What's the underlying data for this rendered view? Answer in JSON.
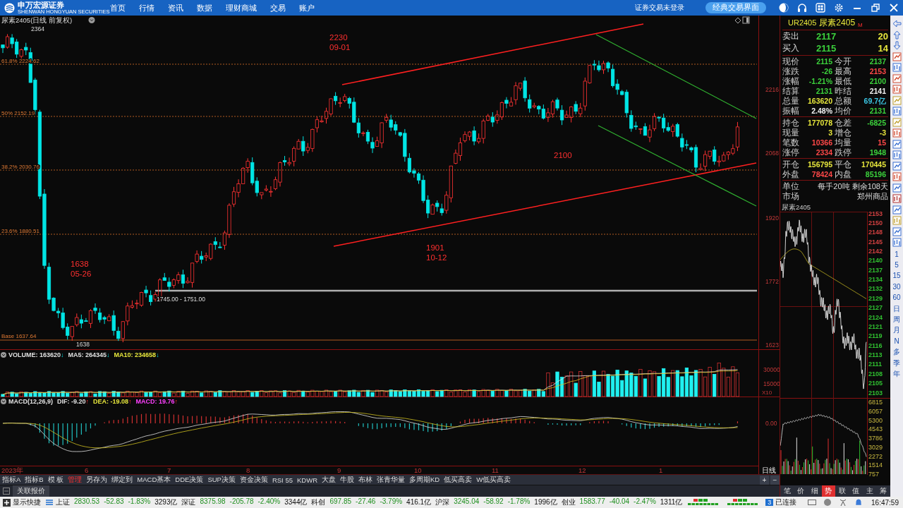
{
  "top_bar": {
    "logo": {
      "name": "申万宏源证券",
      "subtitle": "SHENWAN HONGYUAN SECURITIES"
    },
    "nav": [
      "首页",
      "行情",
      "资讯",
      "数据",
      "理财商城",
      "交易",
      "账户"
    ],
    "login_status": "证券交易未登录",
    "classic_button": "经典交易界面"
  },
  "chart": {
    "title": "尿素2405(日线 前复权)",
    "high_label": "2364",
    "low_label": "1638",
    "fib_levels": [
      {
        "label": "61.8% 2224.62"
      },
      {
        "label": "50% 2152.19"
      },
      {
        "label": "38.2% 2030.76"
      },
      {
        "label": "23.6% 1880.51"
      }
    ],
    "base_label": "Base 1637.64",
    "range_label": "1745.00 - 1751.00",
    "annotations": [
      {
        "price": "2230",
        "date": "09-01"
      },
      {
        "price": "1638",
        "date": "05-26"
      },
      {
        "price": "1901",
        "date": "10-12"
      },
      {
        "price": "2100"
      }
    ],
    "price_axis": [
      "2216",
      "2068",
      "1920",
      "1772",
      "1623"
    ],
    "volume": {
      "readings": [
        {
          "label": "VOLUME: 163620",
          "arrow": "↓",
          "color": "#e0e0e0"
        },
        {
          "label": "MA5: 264345",
          "arrow": "↓",
          "color": "#e0e0e0"
        },
        {
          "label": "MA10: 234658",
          "arrow": "↓",
          "color": "#e6e63c"
        }
      ],
      "axis": [
        "30000",
        "15000"
      ],
      "unit": "X10"
    },
    "macd": {
      "name": "MACD(12,26,9)",
      "readings": [
        {
          "label": "DIF: -9.20",
          "arrow": "↑",
          "color": "#e0e0e0"
        },
        {
          "label": "DEA: -19.08",
          "arrow": "↑",
          "color": "#e6e63c"
        },
        {
          "label": "MACD: 19.76",
          "arrow": "↑",
          "color": "#ff40ff"
        }
      ],
      "axis": "0.00"
    },
    "date_axis": [
      "2023年",
      "6",
      "7",
      "8",
      "9",
      "10",
      "11",
      "12",
      "1"
    ],
    "period_label": "日线"
  },
  "quote": {
    "code": "UR2405",
    "name": "尿素2405",
    "flag": "M",
    "bid_ask": [
      {
        "label": "卖出",
        "price": "2117",
        "volume": "20"
      },
      {
        "label": "买入",
        "price": "2115",
        "volume": "14"
      }
    ],
    "groups": [
      [
        {
          "label": "现价",
          "value": "2115",
          "color": "#3cd23c"
        },
        {
          "label": "今开",
          "value": "2137",
          "color": "#3cd23c"
        },
        {
          "label": "涨跌",
          "value": "-26",
          "color": "#3cd23c"
        },
        {
          "label": "最高",
          "value": "2153",
          "color": "#ff4848"
        },
        {
          "label": "涨幅",
          "value": "-1.21%",
          "color": "#3cd23c"
        },
        {
          "label": "最低",
          "value": "2100",
          "color": "#3cd23c"
        },
        {
          "label": "结算",
          "value": "2131",
          "color": "#3cd23c"
        },
        {
          "label": "昨结",
          "value": "2141",
          "color": "#f0f0f0"
        },
        {
          "label": "总量",
          "value": "163620",
          "color": "#e6e63c"
        },
        {
          "label": "总额",
          "value": "69.7亿",
          "color": "#3cc8e6"
        },
        {
          "label": "振幅",
          "value": "2.48%",
          "color": "#f0f0f0"
        },
        {
          "label": "均价",
          "value": "2131",
          "color": "#3cd23c"
        }
      ],
      [
        {
          "label": "持仓",
          "value": "177078",
          "color": "#e6e63c"
        },
        {
          "label": "仓差",
          "value": "-6825",
          "color": "#3cd23c"
        },
        {
          "label": "现量",
          "value": "3",
          "color": "#e6e63c"
        },
        {
          "label": "增仓",
          "value": "-3",
          "color": "#e6e63c"
        },
        {
          "label": "笔数",
          "value": "10366",
          "color": "#ff4848"
        },
        {
          "label": "均量",
          "value": "15",
          "color": "#ff4848"
        },
        {
          "label": "涨停",
          "value": "2334",
          "color": "#ff4848"
        },
        {
          "label": "跌停",
          "value": "1948",
          "color": "#3cd23c"
        }
      ],
      [
        {
          "label": "开仓",
          "value": "156795",
          "color": "#e6e63c"
        },
        {
          "label": "平仓",
          "value": "170445",
          "color": "#e6e63c"
        },
        {
          "label": "外盘",
          "value": "78424",
          "color": "#ff4848"
        },
        {
          "label": "内盘",
          "value": "85196",
          "color": "#3cd23c"
        }
      ]
    ],
    "info": [
      {
        "label": "单位",
        "value": "每手20吨 剩余108天"
      },
      {
        "label": "市场",
        "value": "郑州商品"
      }
    ]
  },
  "intraday": {
    "title": "尿素2405",
    "price_axis": [
      {
        "value": "2153",
        "color": "#d04040"
      },
      {
        "value": "2150",
        "color": "#d04040"
      },
      {
        "value": "2148",
        "color": "#d04040"
      },
      {
        "value": "2145",
        "color": "#d04040"
      },
      {
        "value": "2142",
        "color": "#d04040"
      },
      {
        "value": "2140",
        "color": "#30c030"
      },
      {
        "value": "2137",
        "color": "#30c030"
      },
      {
        "value": "2134",
        "color": "#30c030"
      },
      {
        "value": "2132",
        "color": "#30c030"
      },
      {
        "value": "2129",
        "color": "#30c030"
      },
      {
        "value": "2127",
        "color": "#30c030"
      },
      {
        "value": "2124",
        "color": "#30c030"
      },
      {
        "value": "2121",
        "color": "#30c030"
      },
      {
        "value": "2119",
        "color": "#30c030"
      },
      {
        "value": "2116",
        "color": "#30c030"
      },
      {
        "value": "2113",
        "color": "#30c030"
      },
      {
        "value": "2111",
        "color": "#30c030"
      },
      {
        "value": "2108",
        "color": "#30c030"
      },
      {
        "value": "2105",
        "color": "#30c030"
      },
      {
        "value": "2103",
        "color": "#30c030"
      }
    ],
    "volume_axis": [
      "6815",
      "6057",
      "5300",
      "4543",
      "3786",
      "3029",
      "2272",
      "1514",
      "757"
    ],
    "tabs": [
      {
        "label": "笔",
        "selected": false
      },
      {
        "label": "价",
        "selected": false
      },
      {
        "label": "细",
        "selected": false
      },
      {
        "label": "势",
        "selected": true
      },
      {
        "label": "联",
        "selected": false
      },
      {
        "label": "值",
        "selected": false
      },
      {
        "label": "主",
        "selected": false
      },
      {
        "label": "筹",
        "selected": false
      }
    ]
  },
  "sidebar": {
    "periods": [
      "1",
      "5",
      "15",
      "30",
      "60",
      "日",
      "周",
      "月",
      "N",
      "多",
      "季",
      "年"
    ]
  },
  "indicator_tabs": [
    {
      "label": "指标A",
      "selected": false
    },
    {
      "label": "指标B",
      "selected": false
    },
    {
      "label": "模 板",
      "selected": false
    },
    {
      "label": "管理",
      "selected": true
    },
    {
      "label": "另存为",
      "selected": false
    },
    {
      "label": "绑定到",
      "selected": false
    },
    {
      "label": "MACD基本",
      "selected": false
    },
    {
      "label": "DDE决策",
      "selected": false
    },
    {
      "label": "SUP决策",
      "selected": false
    },
    {
      "label": "资金决策",
      "selected": false
    },
    {
      "label": "RSI 55",
      "selected": false
    },
    {
      "label": "KDWR",
      "selected": false
    },
    {
      "label": "大盘",
      "selected": false
    },
    {
      "label": "牛股",
      "selected": false
    },
    {
      "label": "布林",
      "selected": false
    },
    {
      "label": "张青华量",
      "selected": false
    },
    {
      "label": "多周期KD",
      "selected": false
    },
    {
      "label": "低买高卖",
      "selected": false
    },
    {
      "label": "W低买高卖",
      "selected": false
    }
  ],
  "zoom_buttons": [
    "+",
    "−"
  ],
  "linked_quotes": "关联报价",
  "status_bar": {
    "shortcut": "显示快捷",
    "indices": [
      {
        "name": "上证",
        "value": "2830.53",
        "change": "-52.83",
        "percent": "-1.83%",
        "turnover": "3293亿"
      },
      {
        "name": "深证",
        "value": "8375.98",
        "change": "-205.78",
        "percent": "-2.40%",
        "turnover": "3344亿"
      },
      {
        "name": "科创",
        "value": "697.85",
        "change": "-27.46",
        "percent": "-3.79%",
        "turnover": "416.1亿"
      },
      {
        "name": "沪深",
        "value": "3245.04",
        "change": "-58.92",
        "percent": "-1.78%",
        "turnover": "1996亿"
      },
      {
        "name": "创业",
        "value": "1583.77",
        "change": "-40.04",
        "percent": "-2.47%",
        "turnover": "1311亿"
      }
    ],
    "connection": {
      "count": "3",
      "label": "已连接"
    },
    "time": "16:47:59"
  }
}
